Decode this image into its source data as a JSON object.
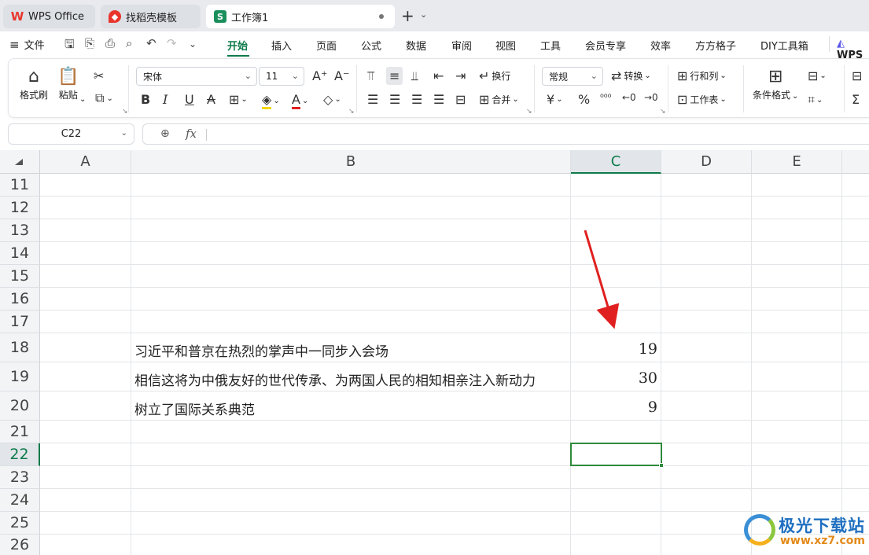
{
  "tabs": {
    "wps": "WPS Office",
    "template": "找稻壳模板",
    "workbook": "工作簿1"
  },
  "menu": {
    "file": "文件",
    "items": [
      "开始",
      "插入",
      "页面",
      "公式",
      "数据",
      "审阅",
      "视图",
      "工具",
      "会员专享",
      "效率",
      "方方格子",
      "DIY工具箱"
    ],
    "wps_ai": "WPS"
  },
  "ribbon": {
    "format_painter": "格式刷",
    "paste": "粘贴",
    "font_name": "宋体",
    "font_size": "11",
    "wrap": "换行",
    "merge": "合并",
    "number_format": "常规",
    "convert": "转换",
    "rows_cols": "行和列",
    "worksheet": "工作表",
    "cond_format": "条件格式"
  },
  "formula_bar": {
    "cell_ref": "C22",
    "fx": "fx",
    "content": ""
  },
  "sheet": {
    "columns": [
      "A",
      "B",
      "C",
      "D",
      "E"
    ],
    "selected_column": "C",
    "rows": [
      "11",
      "12",
      "13",
      "14",
      "15",
      "16",
      "17",
      "18",
      "19",
      "20",
      "21",
      "22",
      "23",
      "24",
      "25",
      "26"
    ],
    "selected_row": "22",
    "cells": {
      "B18": "习近平和普京在热烈的掌声中一同步入会场",
      "B19": "相信这将为中俄友好的世代传承、为两国人民的相知相亲注入新动力",
      "B20": "树立了国际关系典范",
      "C18": "19",
      "C19": "30",
      "C20": "9"
    }
  },
  "annotation": {
    "arrow_color": "#e02020"
  },
  "watermark": {
    "title": "极光下载站",
    "url": "www.xz7.com"
  },
  "colors": {
    "accent": "#0e7a4b",
    "selection": "#2f8a3b"
  }
}
